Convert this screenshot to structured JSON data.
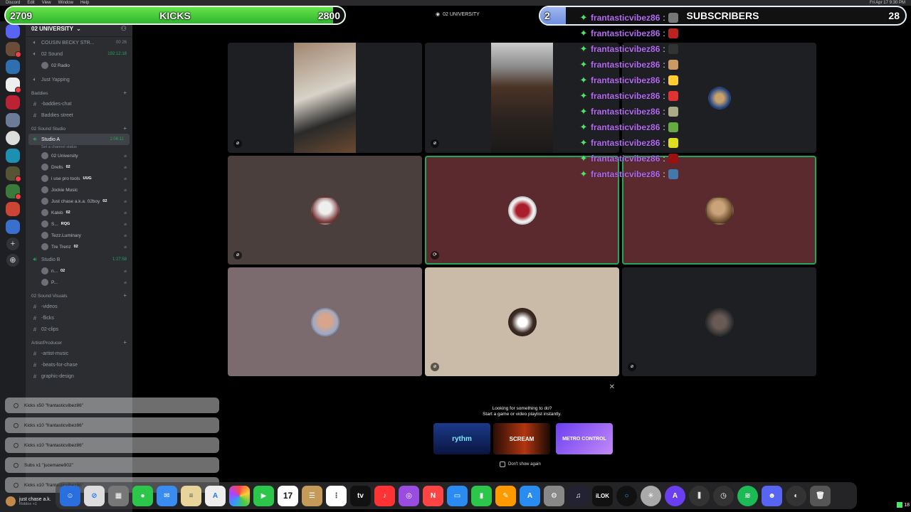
{
  "menubar": {
    "items": [
      "Discord",
      "Edit",
      "View",
      "Window",
      "Help"
    ],
    "clock": "Fri Apr 17  9:30 PM"
  },
  "server": {
    "name": "02 UNIVERSITY"
  },
  "sidebar": {
    "top_channels": [
      {
        "name": "COUSIN BECKY STR...",
        "extra": "00  26",
        "icon": "speaker-icon"
      },
      {
        "name": "02 Sound",
        "extra": "192:12:18",
        "icon": "speaker-icon"
      }
    ],
    "sound_sub": "02 Radio",
    "yapping": "Just Yapping",
    "cat_baddies": "Baddies",
    "baddies_channels": [
      "-baddies-chat",
      "Baddies street"
    ],
    "cat_studio": "02 Sound Studio",
    "studio_a": {
      "name": "Studio A",
      "timer": "1:06:11",
      "status": "Set a channel status"
    },
    "studio_a_users": [
      {
        "name": "02 University",
        "badge": ""
      },
      {
        "name": "Drells",
        "badge": "02"
      },
      {
        "name": "i use pro tools",
        "badge": "UUG"
      },
      {
        "name": "Jockie Music",
        "badge": ""
      },
      {
        "name": "Just chase a.k.a. 02boy",
        "badge": "02"
      },
      {
        "name": "Kaleb",
        "badge": "02"
      },
      {
        "name": "S...",
        "badge": "RQG"
      },
      {
        "name": "Tezz.Luminary",
        "badge": ""
      },
      {
        "name": "Tre Trenz",
        "badge": "02"
      }
    ],
    "studio_b": {
      "name": "Studio B",
      "timer": "1:27:58"
    },
    "studio_b_users": [
      {
        "name": "n...",
        "badge": "02"
      },
      {
        "name": "P...",
        "badge": ""
      }
    ],
    "cat_visuals": "02 Sound Visuals",
    "visual_channels": [
      "-videos",
      "-flicks",
      "02-clips"
    ],
    "cat_artist": "Artist/Producer",
    "artist_channels": [
      "-artist-music",
      "-beats-for-chase",
      "graphic-design"
    ]
  },
  "user_panel": {
    "name": "just chase a.k.",
    "status": "Roblox +1"
  },
  "main": {
    "title": "02 UNIVERSITY"
  },
  "activity": {
    "line1": "Looking for something to do?",
    "line2": "Start a game or video playlist instantly.",
    "cards": [
      "rythm",
      "SCREAM",
      "METRO CONTROL"
    ],
    "dont_show": "Don't show again"
  },
  "overlay": {
    "kicks": {
      "current": "2709",
      "label": "KICKS",
      "goal": "2800",
      "progress": 0.967
    },
    "subs": {
      "current": "2",
      "label": "SUBSCRIBERS",
      "goal": "28",
      "progress": 0.07
    },
    "chat_name": "frantasticvibez86",
    "chat_lines": 11,
    "emote_colors": [
      "#777",
      "#b22",
      "#333",
      "#c96",
      "#fc3",
      "#d33",
      "#aa8",
      "#6a4",
      "#dd2",
      "#911",
      "#47a",
      "#f90"
    ],
    "alerts": [
      "Kicks x50 \"frantasticvibez86\"",
      "Kicks x10 \"frantasticvibez86\"",
      "Kicks x10 \"frantasticvibez86\"",
      "Subs x1 \"jucemane902\"",
      "Kicks x10 \"frantasticvibez86\""
    ]
  },
  "dock": {
    "calendar_day": "17",
    "tv_label": "tv",
    "corner_count": "18"
  },
  "colors": {
    "accent_green": "#23a55a",
    "tile_maroon": "#5a2a2f",
    "tile_taupe": "#7b6b6f",
    "tile_beige": "#c9bba8"
  }
}
